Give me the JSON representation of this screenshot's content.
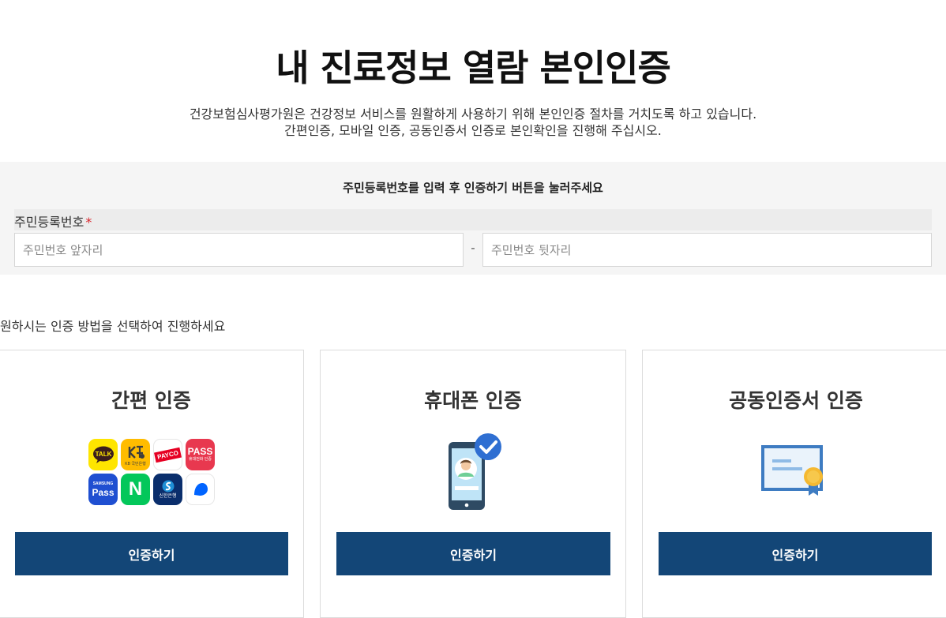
{
  "page": {
    "title": "내 진료정보 열람 본인인증",
    "desc_line1": "건강보험심사평가원은 건강정보 서비스를 원활하게 사용하기 위해 본인인증 절차를 거치도록 하고 있습니다.",
    "desc_line2": "간편인증, 모바일 인증, 공동인증서 인증로 본인확인을 진행해 주십시오."
  },
  "rrn": {
    "instruction": "주민등록번호를 입력 후 인증하기 버튼을 눌러주세요",
    "label": "주민등록번호",
    "required_mark": "*",
    "front_placeholder": "주민번호 앞자리",
    "back_placeholder": "주민번호 뒷자리",
    "separator": "-",
    "front_value": "",
    "back_value": ""
  },
  "methods": {
    "guide": "원하시는 인증 방법을 선택하여 진행하세요",
    "cards": [
      {
        "title": "간편 인증",
        "button": "인증하기",
        "logos": [
          {
            "icon": "kakao-talk-icon",
            "text": "TALK"
          },
          {
            "icon": "kb-bank-icon",
            "text": "KB 국민은행"
          },
          {
            "icon": "payco-icon",
            "text": "PAYCO"
          },
          {
            "icon": "pass-icon",
            "text": "PASS",
            "sub": "휴대전화 인증"
          },
          {
            "icon": "samsung-pass-icon",
            "text": "Pass",
            "sub": "SAMSUNG"
          },
          {
            "icon": "naver-icon",
            "text": "N"
          },
          {
            "icon": "shinhan-bank-icon",
            "text": "신한은행"
          },
          {
            "icon": "toss-icon",
            "text": ""
          }
        ]
      },
      {
        "title": "휴대폰 인증",
        "button": "인증하기",
        "icon": "mobile-phone-verified-icon"
      },
      {
        "title": "공동인증서 인증",
        "button": "인증하기",
        "icon": "certificate-icon"
      }
    ]
  },
  "colors": {
    "primary_button": "#134677",
    "panel_bg": "#f5f5f5",
    "required": "#d8232a",
    "kakao": "#fee500",
    "kb": "#ffbc00",
    "payco": "#e60023",
    "pass": "#e8384f",
    "samsung": "#1f4fd1",
    "naver": "#03c75a",
    "shinhan": "#0a2e6c",
    "toss": "#0064ff"
  }
}
